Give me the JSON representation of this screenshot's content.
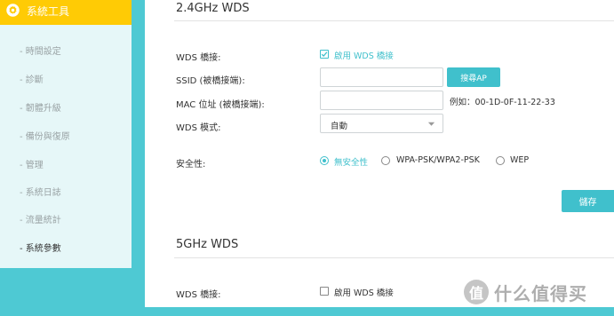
{
  "sidebar": {
    "title": "系統工具",
    "items": [
      {
        "label": "- 時間設定"
      },
      {
        "label": "- 診斷"
      },
      {
        "label": "- 韌體升級"
      },
      {
        "label": "- 備份與復原"
      },
      {
        "label": "- 管理"
      },
      {
        "label": "- 系統日誌"
      },
      {
        "label": "- 流量統計"
      },
      {
        "label": "- 系統參數"
      }
    ],
    "active_index": 7
  },
  "wds24": {
    "title": "2.4GHz WDS",
    "bridge_label": "WDS 橋接:",
    "bridge_checkbox_label": "啟用 WDS 橋接",
    "bridge_checked": true,
    "ssid_label": "SSID (被橋接端):",
    "ssid_value": "",
    "scan_button": "搜尋AP",
    "mac_label": "MAC 位址 (被橋接端):",
    "mac_value": "",
    "mac_example": "例如：00-1D-0F-11-22-33",
    "mode_label": "WDS 模式:",
    "mode_value": "自動",
    "security_label": "安全性:",
    "security_options": [
      {
        "label": "無安全性",
        "selected": true
      },
      {
        "label": "WPA-PSK/WPA2-PSK",
        "selected": false
      },
      {
        "label": "WEP",
        "selected": false
      }
    ],
    "save_button": "儲存"
  },
  "wds5": {
    "title": "5GHz WDS",
    "bridge_label": "WDS 橋接:",
    "bridge_checkbox_label": "啟用 WDS 橋接",
    "bridge_checked": false
  },
  "watermark": {
    "logo_char": "值",
    "text": "什么值得买"
  },
  "colors": {
    "accent": "#40c0cc",
    "header_yellow": "#ffcb05",
    "sidebar_bg": "#e6f7f8",
    "page_bg": "#4ec9d3"
  }
}
